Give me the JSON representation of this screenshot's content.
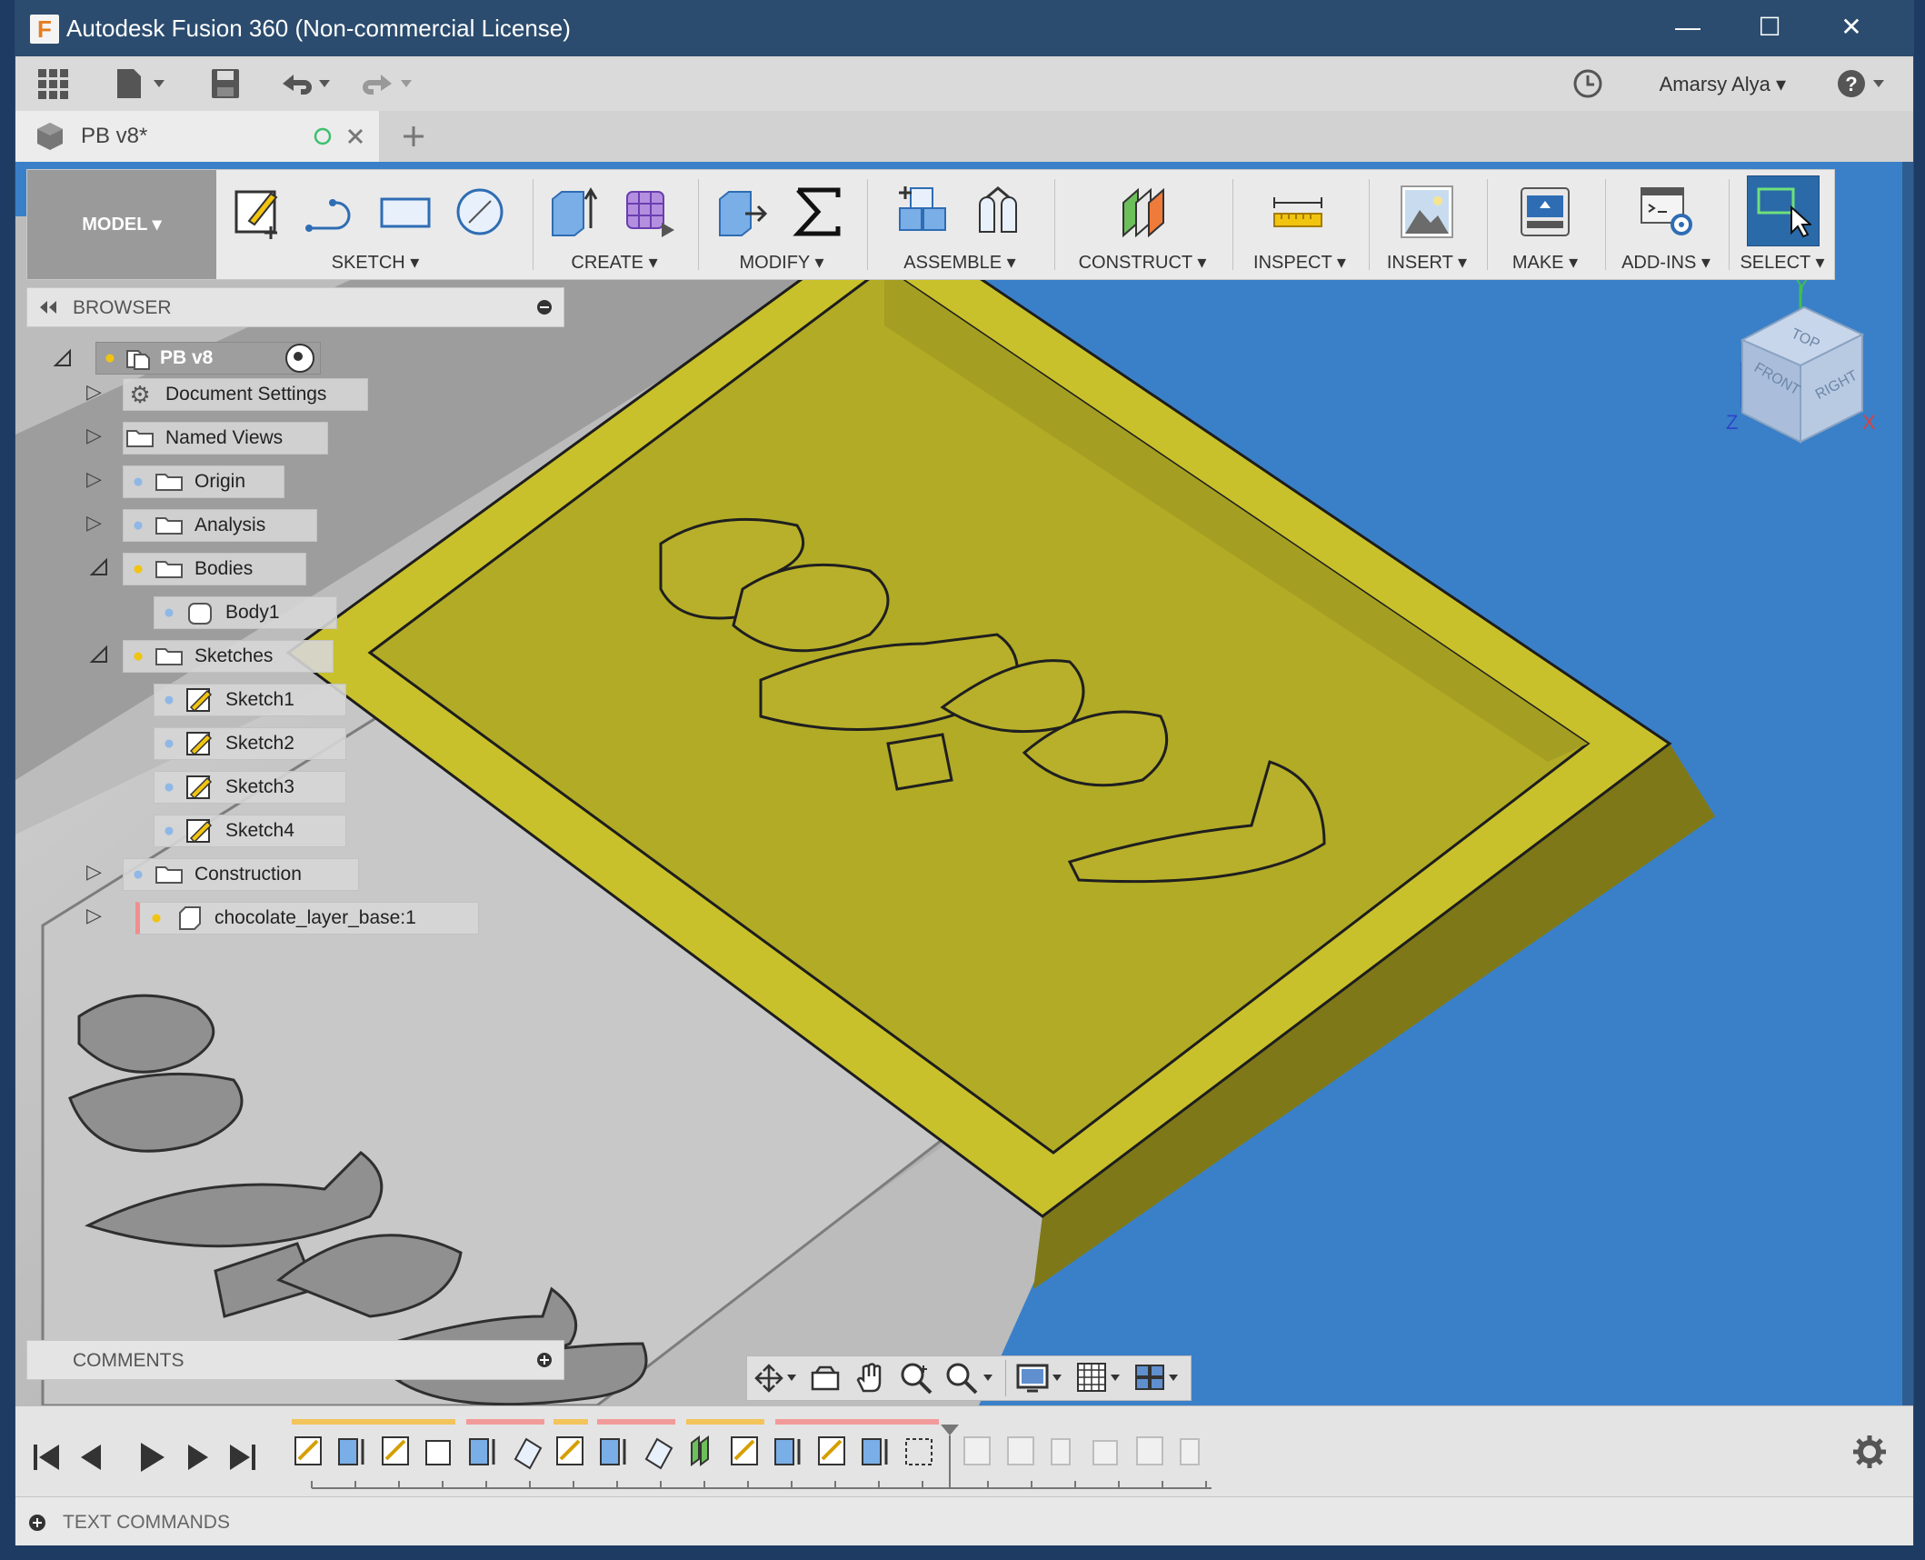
{
  "window": {
    "title": "Autodesk Fusion 360 (Non-commercial License)",
    "controls": [
      "—",
      "☐",
      "✕"
    ]
  },
  "topbar": {
    "user_name": "Amarsy Alya"
  },
  "document_tab": {
    "title": "PB v8*"
  },
  "ribbon": {
    "workspace": "MODEL",
    "groups": [
      {
        "label": "SKETCH"
      },
      {
        "label": "CREATE"
      },
      {
        "label": "MODIFY"
      },
      {
        "label": "ASSEMBLE"
      },
      {
        "label": "CONSTRUCT"
      },
      {
        "label": "INSPECT"
      },
      {
        "label": "INSERT"
      },
      {
        "label": "MAKE"
      },
      {
        "label": "ADD-INS"
      },
      {
        "label": "SELECT"
      }
    ]
  },
  "browser": {
    "title": "BROWSER",
    "items": [
      {
        "label": "PB v8"
      },
      {
        "label": "Document Settings"
      },
      {
        "label": "Named Views"
      },
      {
        "label": "Origin"
      },
      {
        "label": "Analysis"
      },
      {
        "label": "Bodies"
      },
      {
        "label": "Body1"
      },
      {
        "label": "Sketches"
      },
      {
        "label": "Sketch1"
      },
      {
        "label": "Sketch2"
      },
      {
        "label": "Sketch3"
      },
      {
        "label": "Sketch4"
      },
      {
        "label": "Construction"
      },
      {
        "label": "chocolate_layer_base:1"
      }
    ]
  },
  "viewcube": {
    "top": "TOP",
    "front": "FRONT",
    "right": "RIGHT",
    "axis_x": "X",
    "axis_y": "Y",
    "axis_z": "Z"
  },
  "comments": {
    "title": "COMMENTS"
  },
  "text_commands": {
    "label": "TEXT COMMANDS"
  },
  "colors": {
    "viewport_bg": "#3a80c8",
    "tray_yellow": "#b2ab26",
    "titlebar": "#2b4c6e"
  }
}
